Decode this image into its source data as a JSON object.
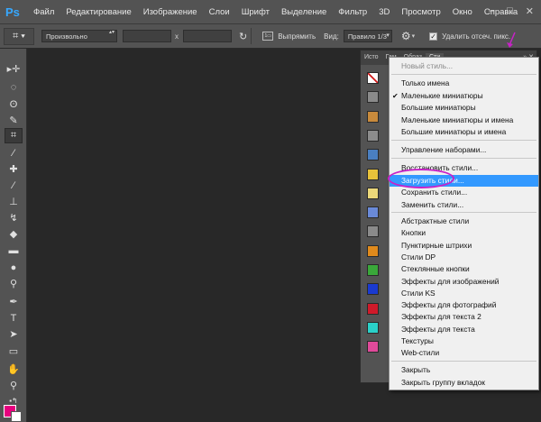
{
  "app": {
    "logo": "Ps"
  },
  "menubar": {
    "items": [
      "Файл",
      "Редактирование",
      "Изображение",
      "Слои",
      "Шрифт",
      "Выделение",
      "Фильтр",
      "3D",
      "Просмотр",
      "Окно",
      "Справка"
    ],
    "controls": [
      "–",
      "□",
      "✕"
    ]
  },
  "options": {
    "ratio_value": "Произвольно",
    "x_label": "x",
    "straighten_label": "Выпрямить",
    "view_label": "Вид:",
    "view_value": "Правило 1/3",
    "delete_crop_label": "Удалить отсеч. пикс."
  },
  "panel": {
    "tabs": [
      "Исто",
      "Гам",
      "Образ",
      "Сти"
    ],
    "swatch_colors": [
      "#ffffff",
      "#8a8a8a",
      "#c88a3c",
      "#8c8c8c",
      "#4a7fc0",
      "#e8c23a",
      "#ecd87a",
      "#6a8ad8",
      "#8a8a8a",
      "#e08a1c",
      "#3aa83a",
      "#1a3ad0",
      "#d01a2a",
      "#2ad0c8",
      "#e04a9a"
    ]
  },
  "flyout": {
    "new_style": "Новый стиль...",
    "view_items": [
      "Только имена",
      "Маленькие миниатюры",
      "Большие миниатюры",
      "Маленькие миниатюры и имена",
      "Большие миниатюры и имена"
    ],
    "manage": "Управление наборами...",
    "file_items": [
      "Восстановить стили...",
      "Загрузить стили...",
      "Сохранить стили...",
      "Заменить стили..."
    ],
    "libraries": [
      "Абстрактные стили",
      "Кнопки",
      "Пунктирные штрихи",
      "Стили DP",
      "Стеклянные кнопки",
      "Эффекты для изображений",
      "Стили KS",
      "Эффекты для фотографий",
      "Эффекты для текста 2",
      "Эффекты для текста",
      "Текстуры",
      "Web-стили"
    ],
    "close_items": [
      "Закрыть",
      "Закрыть группу вкладок"
    ]
  },
  "colors": {
    "foreground": "#e6007e",
    "background": "#ffffff",
    "highlight": "#3399ff",
    "annotation": "#c822c8"
  }
}
